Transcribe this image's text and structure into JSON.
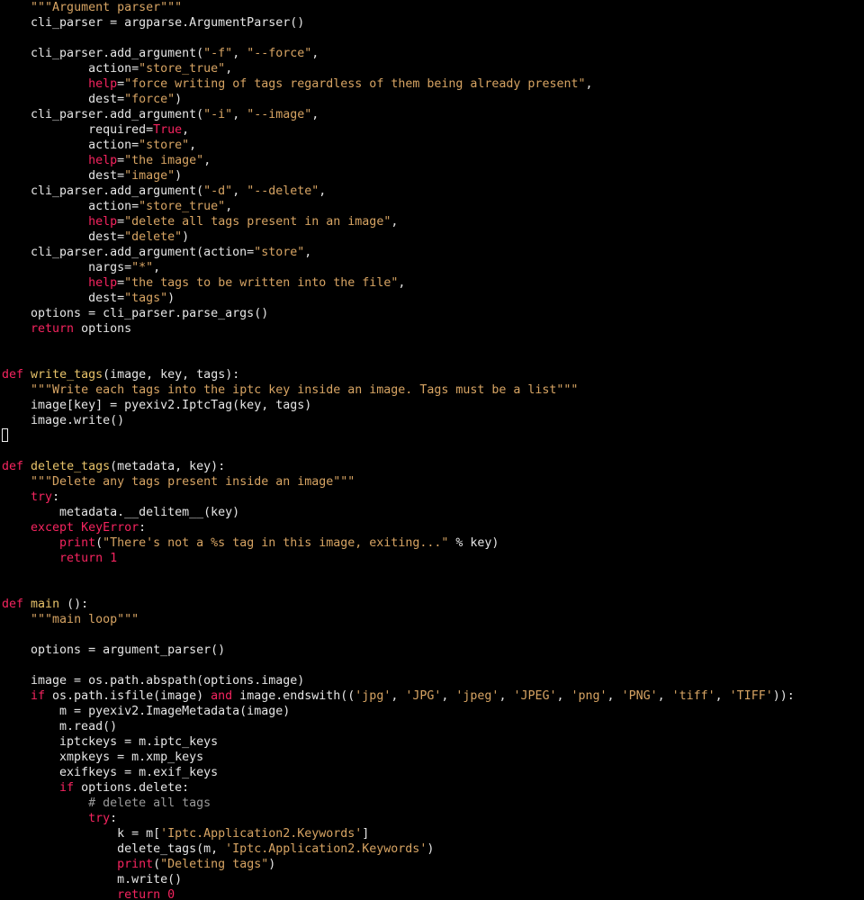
{
  "editor": {
    "lines": [
      [
        {
          "t": "    ",
          "c": "plain"
        },
        {
          "t": "\"\"\"Argument parser\"\"\"",
          "c": "str"
        }
      ],
      [
        {
          "t": "    cli_parser = argparse.ArgumentParser()",
          "c": "plain"
        }
      ],
      [],
      [
        {
          "t": "    cli_parser.add_argument(",
          "c": "plain"
        },
        {
          "t": "\"-f\"",
          "c": "str"
        },
        {
          "t": ", ",
          "c": "plain"
        },
        {
          "t": "\"--force\"",
          "c": "str"
        },
        {
          "t": ",",
          "c": "plain"
        }
      ],
      [
        {
          "t": "            action=",
          "c": "plain"
        },
        {
          "t": "\"store_true\"",
          "c": "str"
        },
        {
          "t": ",",
          "c": "plain"
        }
      ],
      [
        {
          "t": "            ",
          "c": "plain"
        },
        {
          "t": "help",
          "c": "builtin"
        },
        {
          "t": "=",
          "c": "plain"
        },
        {
          "t": "\"force writing of tags regardless of them being already present\"",
          "c": "str"
        },
        {
          "t": ",",
          "c": "plain"
        }
      ],
      [
        {
          "t": "            dest=",
          "c": "plain"
        },
        {
          "t": "\"force\"",
          "c": "str"
        },
        {
          "t": ")",
          "c": "plain"
        }
      ],
      [
        {
          "t": "    cli_parser.add_argument(",
          "c": "plain"
        },
        {
          "t": "\"-i\"",
          "c": "str"
        },
        {
          "t": ", ",
          "c": "plain"
        },
        {
          "t": "\"--image\"",
          "c": "str"
        },
        {
          "t": ",",
          "c": "plain"
        }
      ],
      [
        {
          "t": "            required=",
          "c": "plain"
        },
        {
          "t": "True",
          "c": "const"
        },
        {
          "t": ",",
          "c": "plain"
        }
      ],
      [
        {
          "t": "            action=",
          "c": "plain"
        },
        {
          "t": "\"store\"",
          "c": "str"
        },
        {
          "t": ",",
          "c": "plain"
        }
      ],
      [
        {
          "t": "            ",
          "c": "plain"
        },
        {
          "t": "help",
          "c": "builtin"
        },
        {
          "t": "=",
          "c": "plain"
        },
        {
          "t": "\"the image\"",
          "c": "str"
        },
        {
          "t": ",",
          "c": "plain"
        }
      ],
      [
        {
          "t": "            dest=",
          "c": "plain"
        },
        {
          "t": "\"image\"",
          "c": "str"
        },
        {
          "t": ")",
          "c": "plain"
        }
      ],
      [
        {
          "t": "    cli_parser.add_argument(",
          "c": "plain"
        },
        {
          "t": "\"-d\"",
          "c": "str"
        },
        {
          "t": ", ",
          "c": "plain"
        },
        {
          "t": "\"--delete\"",
          "c": "str"
        },
        {
          "t": ",",
          "c": "plain"
        }
      ],
      [
        {
          "t": "            action=",
          "c": "plain"
        },
        {
          "t": "\"store_true\"",
          "c": "str"
        },
        {
          "t": ",",
          "c": "plain"
        }
      ],
      [
        {
          "t": "            ",
          "c": "plain"
        },
        {
          "t": "help",
          "c": "builtin"
        },
        {
          "t": "=",
          "c": "plain"
        },
        {
          "t": "\"delete all tags present in an image\"",
          "c": "str"
        },
        {
          "t": ",",
          "c": "plain"
        }
      ],
      [
        {
          "t": "            dest=",
          "c": "plain"
        },
        {
          "t": "\"delete\"",
          "c": "str"
        },
        {
          "t": ")",
          "c": "plain"
        }
      ],
      [
        {
          "t": "    cli_parser.add_argument(action=",
          "c": "plain"
        },
        {
          "t": "\"store\"",
          "c": "str"
        },
        {
          "t": ",",
          "c": "plain"
        }
      ],
      [
        {
          "t": "            nargs=",
          "c": "plain"
        },
        {
          "t": "\"*\"",
          "c": "str"
        },
        {
          "t": ",",
          "c": "plain"
        }
      ],
      [
        {
          "t": "            ",
          "c": "plain"
        },
        {
          "t": "help",
          "c": "builtin"
        },
        {
          "t": "=",
          "c": "plain"
        },
        {
          "t": "\"the tags to be written into the file\"",
          "c": "str"
        },
        {
          "t": ",",
          "c": "plain"
        }
      ],
      [
        {
          "t": "            dest=",
          "c": "plain"
        },
        {
          "t": "\"tags\"",
          "c": "str"
        },
        {
          "t": ")",
          "c": "plain"
        }
      ],
      [
        {
          "t": "    options = cli_parser.parse_args()",
          "c": "plain"
        }
      ],
      [
        {
          "t": "    ",
          "c": "plain"
        },
        {
          "t": "return",
          "c": "kw"
        },
        {
          "t": " options",
          "c": "plain"
        }
      ],
      [],
      [],
      [
        {
          "t": "def",
          "c": "kw"
        },
        {
          "t": " ",
          "c": "plain"
        },
        {
          "t": "write_tags",
          "c": "fn"
        },
        {
          "t": "(image, key, tags):",
          "c": "plain"
        }
      ],
      [
        {
          "t": "    ",
          "c": "plain"
        },
        {
          "t": "\"\"\"Write each tags into the iptc key inside an image. Tags must be a list\"\"\"",
          "c": "str"
        }
      ],
      [
        {
          "t": "    image[key] = pyexiv2.IptcTag(key, tags)",
          "c": "plain"
        }
      ],
      [
        {
          "t": "    image.write()",
          "c": "plain"
        }
      ],
      [
        {
          "t": "",
          "c": "cursor"
        }
      ],
      [],
      [
        {
          "t": "def",
          "c": "kw"
        },
        {
          "t": " ",
          "c": "plain"
        },
        {
          "t": "delete_tags",
          "c": "fn"
        },
        {
          "t": "(metadata, key):",
          "c": "plain"
        }
      ],
      [
        {
          "t": "    ",
          "c": "plain"
        },
        {
          "t": "\"\"\"Delete any tags present inside an image\"\"\"",
          "c": "str"
        }
      ],
      [
        {
          "t": "    ",
          "c": "plain"
        },
        {
          "t": "try",
          "c": "kw"
        },
        {
          "t": ":",
          "c": "plain"
        }
      ],
      [
        {
          "t": "        metadata.__delitem__(key)",
          "c": "plain"
        }
      ],
      [
        {
          "t": "    ",
          "c": "plain"
        },
        {
          "t": "except",
          "c": "kw"
        },
        {
          "t": " ",
          "c": "plain"
        },
        {
          "t": "KeyError",
          "c": "exc"
        },
        {
          "t": ":",
          "c": "plain"
        }
      ],
      [
        {
          "t": "        ",
          "c": "plain"
        },
        {
          "t": "print",
          "c": "builtin"
        },
        {
          "t": "(",
          "c": "plain"
        },
        {
          "t": "\"There's not a %s tag in this image, exiting...\"",
          "c": "str"
        },
        {
          "t": " % key)",
          "c": "plain"
        }
      ],
      [
        {
          "t": "        ",
          "c": "plain"
        },
        {
          "t": "return",
          "c": "kw"
        },
        {
          "t": " ",
          "c": "plain"
        },
        {
          "t": "1",
          "c": "num"
        }
      ],
      [],
      [],
      [
        {
          "t": "def",
          "c": "kw"
        },
        {
          "t": " ",
          "c": "plain"
        },
        {
          "t": "main",
          "c": "fn"
        },
        {
          "t": " ():",
          "c": "plain"
        }
      ],
      [
        {
          "t": "    ",
          "c": "plain"
        },
        {
          "t": "\"\"\"main loop\"\"\"",
          "c": "str"
        }
      ],
      [],
      [
        {
          "t": "    options = argument_parser()",
          "c": "plain"
        }
      ],
      [],
      [
        {
          "t": "    image = os.path.abspath(options.image)",
          "c": "plain"
        }
      ],
      [
        {
          "t": "    ",
          "c": "plain"
        },
        {
          "t": "if",
          "c": "kw"
        },
        {
          "t": " os.path.isfile(image) ",
          "c": "plain"
        },
        {
          "t": "and",
          "c": "kw"
        },
        {
          "t": " image.endswith((",
          "c": "plain"
        },
        {
          "t": "'jpg'",
          "c": "str"
        },
        {
          "t": ", ",
          "c": "plain"
        },
        {
          "t": "'JPG'",
          "c": "str"
        },
        {
          "t": ", ",
          "c": "plain"
        },
        {
          "t": "'jpeg'",
          "c": "str"
        },
        {
          "t": ", ",
          "c": "plain"
        },
        {
          "t": "'JPEG'",
          "c": "str"
        },
        {
          "t": ", ",
          "c": "plain"
        },
        {
          "t": "'png'",
          "c": "str"
        },
        {
          "t": ", ",
          "c": "plain"
        },
        {
          "t": "'PNG'",
          "c": "str"
        },
        {
          "t": ", ",
          "c": "plain"
        },
        {
          "t": "'tiff'",
          "c": "str"
        },
        {
          "t": ", ",
          "c": "plain"
        },
        {
          "t": "'TIFF'",
          "c": "str"
        },
        {
          "t": ")):",
          "c": "plain"
        }
      ],
      [
        {
          "t": "        m = pyexiv2.ImageMetadata(image)",
          "c": "plain"
        }
      ],
      [
        {
          "t": "        m.read()",
          "c": "plain"
        }
      ],
      [
        {
          "t": "        iptckeys = m.iptc_keys",
          "c": "plain"
        }
      ],
      [
        {
          "t": "        xmpkeys = m.xmp_keys",
          "c": "plain"
        }
      ],
      [
        {
          "t": "        exifkeys = m.exif_keys",
          "c": "plain"
        }
      ],
      [
        {
          "t": "        ",
          "c": "plain"
        },
        {
          "t": "if",
          "c": "kw"
        },
        {
          "t": " options.delete:",
          "c": "plain"
        }
      ],
      [
        {
          "t": "            ",
          "c": "plain"
        },
        {
          "t": "# delete all tags",
          "c": "comment"
        }
      ],
      [
        {
          "t": "            ",
          "c": "plain"
        },
        {
          "t": "try",
          "c": "kw"
        },
        {
          "t": ":",
          "c": "plain"
        }
      ],
      [
        {
          "t": "                k = m[",
          "c": "plain"
        },
        {
          "t": "'Iptc.Application2.Keywords'",
          "c": "str"
        },
        {
          "t": "]",
          "c": "plain"
        }
      ],
      [
        {
          "t": "                delete_tags(m, ",
          "c": "plain"
        },
        {
          "t": "'Iptc.Application2.Keywords'",
          "c": "str"
        },
        {
          "t": ")",
          "c": "plain"
        }
      ],
      [
        {
          "t": "                ",
          "c": "plain"
        },
        {
          "t": "print",
          "c": "builtin"
        },
        {
          "t": "(",
          "c": "plain"
        },
        {
          "t": "\"Deleting tags\"",
          "c": "str"
        },
        {
          "t": ")",
          "c": "plain"
        }
      ],
      [
        {
          "t": "                m.write()",
          "c": "plain"
        }
      ],
      [
        {
          "t": "                ",
          "c": "plain"
        },
        {
          "t": "return",
          "c": "kw"
        },
        {
          "t": " ",
          "c": "plain"
        },
        {
          "t": "0",
          "c": "num"
        }
      ]
    ]
  },
  "colors": {
    "background": "#000000",
    "plain": "#e6e6e6",
    "str": "#d7a463",
    "kw": "#f5245f",
    "fn": "#e8c36a",
    "builtin": "#f5245f",
    "const": "#f5245f",
    "exc": "#f5245f",
    "num": "#f5245f",
    "comment": "#9a9a9a",
    "cursor": "#f0f0f0"
  }
}
